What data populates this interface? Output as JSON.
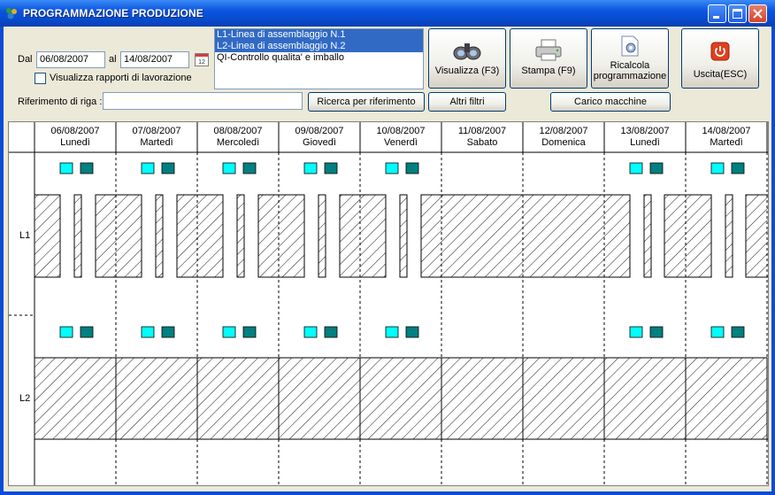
{
  "window": {
    "title": "PROGRAMMAZIONE PRODUZIONE",
    "title_icon": "app-icon",
    "controls": [
      "minimize-icon",
      "maximize-icon",
      "close-icon"
    ]
  },
  "filters": {
    "dal_label": "Dal",
    "dal_value": "06/08/2007",
    "al_label": "al",
    "al_value": "14/08/2007",
    "calendar_icon": "calendar-icon",
    "visualizza_rapporti_label": "Visualizza rapporti di lavorazione",
    "visualizza_rapporti_checked": false,
    "riferimento_label": "Riferimento di riga :",
    "riferimento_value": ""
  },
  "lines_list": [
    {
      "label": "L1-Linea di assemblaggio N.1",
      "selected": true
    },
    {
      "label": "L2-Linea di assemblaggio N.2",
      "selected": true
    },
    {
      "label": "QI-Controllo qualita' e imballo",
      "selected": false
    }
  ],
  "toolbar": {
    "visualizza_label": "Visualizza (F3)",
    "visualizza_icon": "binoculars-icon",
    "stampa_label": "Stampa (F9)",
    "stampa_icon": "printer-icon",
    "ricalcola_line1": "Ricalcola",
    "ricalcola_line2": "programmazione",
    "ricalcola_icon": "document-gear-icon",
    "uscita_label": "Uscita(ESC)",
    "uscita_icon": "power-icon",
    "ricerca_label": "Ricerca per riferimento",
    "altri_filtri_label": "Altri filtri",
    "carico_macchine_label": "Carico macchine"
  },
  "schedule": {
    "days": [
      {
        "date": "06/08/2007",
        "weekday": "Lunedì",
        "markers": true
      },
      {
        "date": "07/08/2007",
        "weekday": "Martedì",
        "markers": true
      },
      {
        "date": "08/08/2007",
        "weekday": "Mercoledì",
        "markers": true
      },
      {
        "date": "09/08/2007",
        "weekday": "Giovedì",
        "markers": true
      },
      {
        "date": "10/08/2007",
        "weekday": "Venerdì",
        "markers": true
      },
      {
        "date": "11/08/2007",
        "weekday": "Sabato",
        "markers": false
      },
      {
        "date": "12/08/2007",
        "weekday": "Domenica",
        "markers": false
      },
      {
        "date": "13/08/2007",
        "weekday": "Lunedì",
        "markers": true
      },
      {
        "date": "14/08/2007",
        "weekday": "Martedì",
        "markers": true
      }
    ],
    "rows": [
      {
        "label": "L1"
      },
      {
        "label": "L2"
      }
    ],
    "colors": {
      "marker_light": "#00FFFF",
      "marker_dark": "#008080",
      "hatch": "#000000"
    }
  }
}
